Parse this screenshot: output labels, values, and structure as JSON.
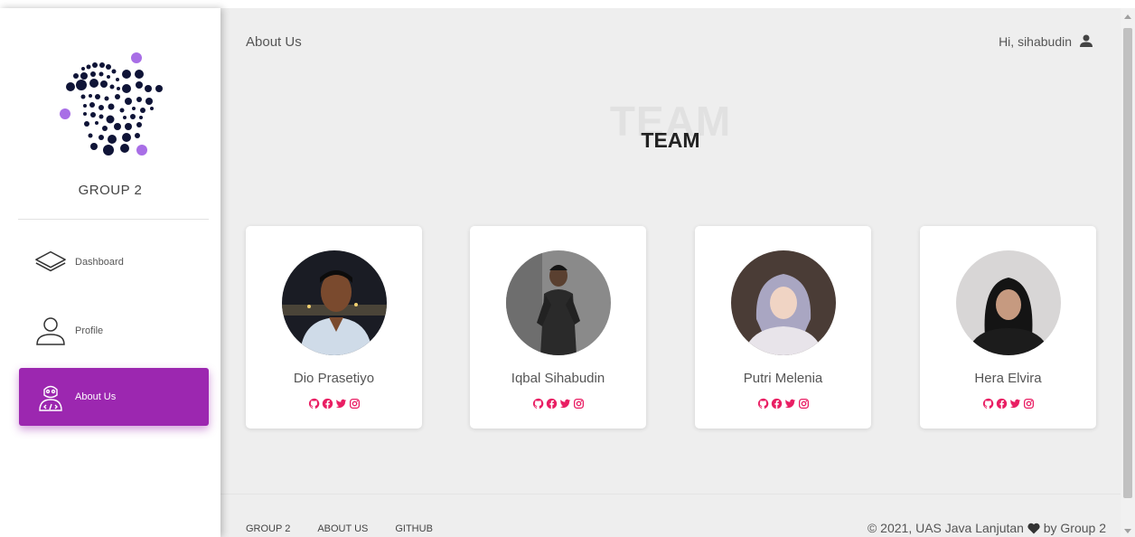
{
  "sidebar": {
    "brand": "GROUP 2",
    "items": [
      {
        "label": "Dashboard",
        "icon": "layers-icon",
        "active": false
      },
      {
        "label": "Profile",
        "icon": "user-outline-icon",
        "active": false
      },
      {
        "label": "About Us",
        "icon": "developer-icon",
        "active": true
      }
    ]
  },
  "header": {
    "title": "About Us",
    "greeting": "Hi, sihabudin",
    "user_icon": "person-icon"
  },
  "section": {
    "ghost_title": "TEAM",
    "title": "TEAM"
  },
  "team": [
    {
      "name": "Dio Prasetiyo",
      "socials": [
        "github-icon",
        "facebook-icon",
        "twitter-icon",
        "instagram-icon"
      ]
    },
    {
      "name": "Iqbal Sihabudin",
      "socials": [
        "github-icon",
        "facebook-icon",
        "twitter-icon",
        "instagram-icon"
      ]
    },
    {
      "name": "Putri Melenia",
      "socials": [
        "github-icon",
        "facebook-icon",
        "twitter-icon",
        "instagram-icon"
      ]
    },
    {
      "name": "Hera Elvira",
      "socials": [
        "github-icon",
        "facebook-icon",
        "twitter-icon",
        "instagram-icon"
      ]
    }
  ],
  "footer": {
    "links": [
      "GROUP 2",
      "ABOUT US",
      "GITHUB"
    ],
    "copyright_prefix": "© 2021, UAS Java Lanjutan",
    "copyright_suffix": "by Group 2"
  },
  "colors": {
    "accent": "#9c27b0",
    "social": "#e91e63",
    "logo_dots": "#0f1437",
    "logo_accent": "#a86ee6"
  }
}
